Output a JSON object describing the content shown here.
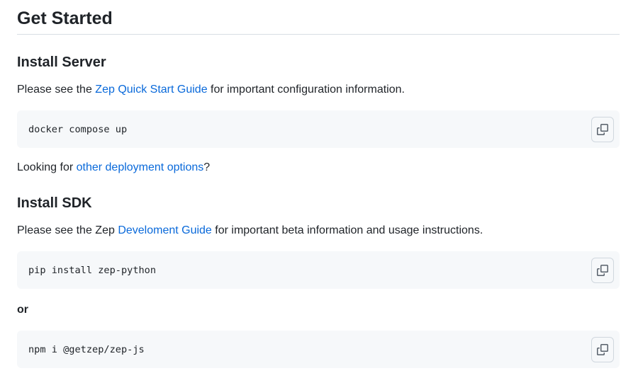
{
  "page_title": "Get Started",
  "install_server": {
    "heading": "Install Server",
    "para_prefix": "Please see the ",
    "link_text": "Zep Quick Start Guide",
    "para_suffix": " for important configuration information.",
    "code": "docker compose up",
    "copy_icon": "copy-icon"
  },
  "deployment": {
    "prefix": "Looking for ",
    "link_text": "other deployment options",
    "suffix": "?"
  },
  "install_sdk": {
    "heading": "Install SDK",
    "para_prefix": "Please see the Zep ",
    "link_text": "Develoment Guide",
    "para_suffix": " for important beta information and usage instructions.",
    "code_python": "pip install zep-python",
    "or_text": "or",
    "code_js": "npm i @getzep/zep-js"
  },
  "colors": {
    "link": "#0969da",
    "code_bg": "#f6f8fa",
    "text": "#1f2328"
  }
}
